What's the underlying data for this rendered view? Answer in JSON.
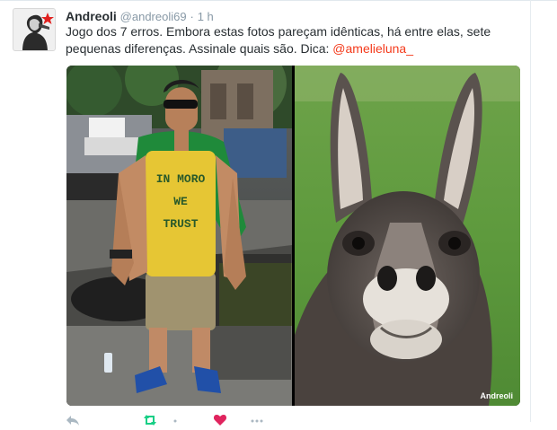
{
  "tweet": {
    "author_name": "Andreoli",
    "author_handle": "@andreoli69",
    "separator": "·",
    "timestamp": "1 h",
    "text_before_mention": "Jogo dos 7 erros. Embora estas fotos pareçam idênticas, há entre elas, sete pequenas diferenças. Assinale quais são. Dica: ",
    "mention": "@amelieluna_"
  },
  "media": {
    "left_photo": {
      "shirt_line1": "IN MORO",
      "shirt_line2": "WE",
      "shirt_line3": "TRUST"
    },
    "right_photo": {
      "watermark": "Andreoli"
    }
  },
  "actions": [
    {
      "icon": "reply-icon"
    },
    {
      "icon": "retweet-icon"
    },
    {
      "icon": "like-icon"
    },
    {
      "icon": "more-icon"
    }
  ],
  "colors": {
    "accent": "#f43a1b",
    "like": "#e0245e",
    "retweet": "#19cf86",
    "muted": "#8899a6",
    "avatar_star": "#e0201e"
  }
}
